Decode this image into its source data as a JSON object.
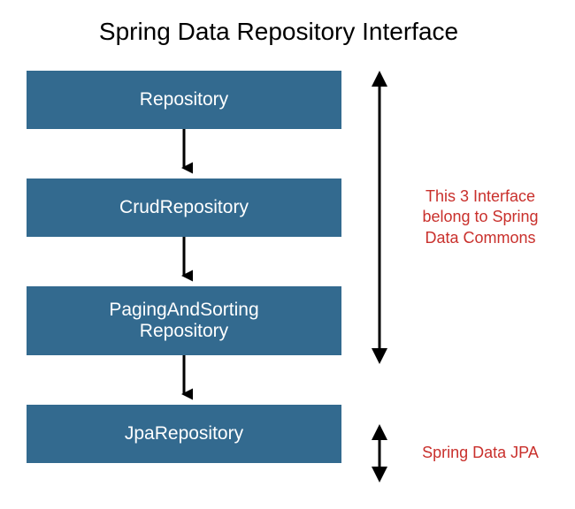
{
  "title": "Spring Data Repository Interface",
  "boxes": {
    "b1": "Repository",
    "b2": "CrudRepository",
    "b3": "PagingAndSorting Repository",
    "b4": "JpaRepository"
  },
  "annotations": {
    "commons": "This 3 Interface belong to Spring Data Commons",
    "jpa": "Spring Data JPA"
  },
  "colors": {
    "box_bg": "#336a8f",
    "label": "#c9302c"
  }
}
